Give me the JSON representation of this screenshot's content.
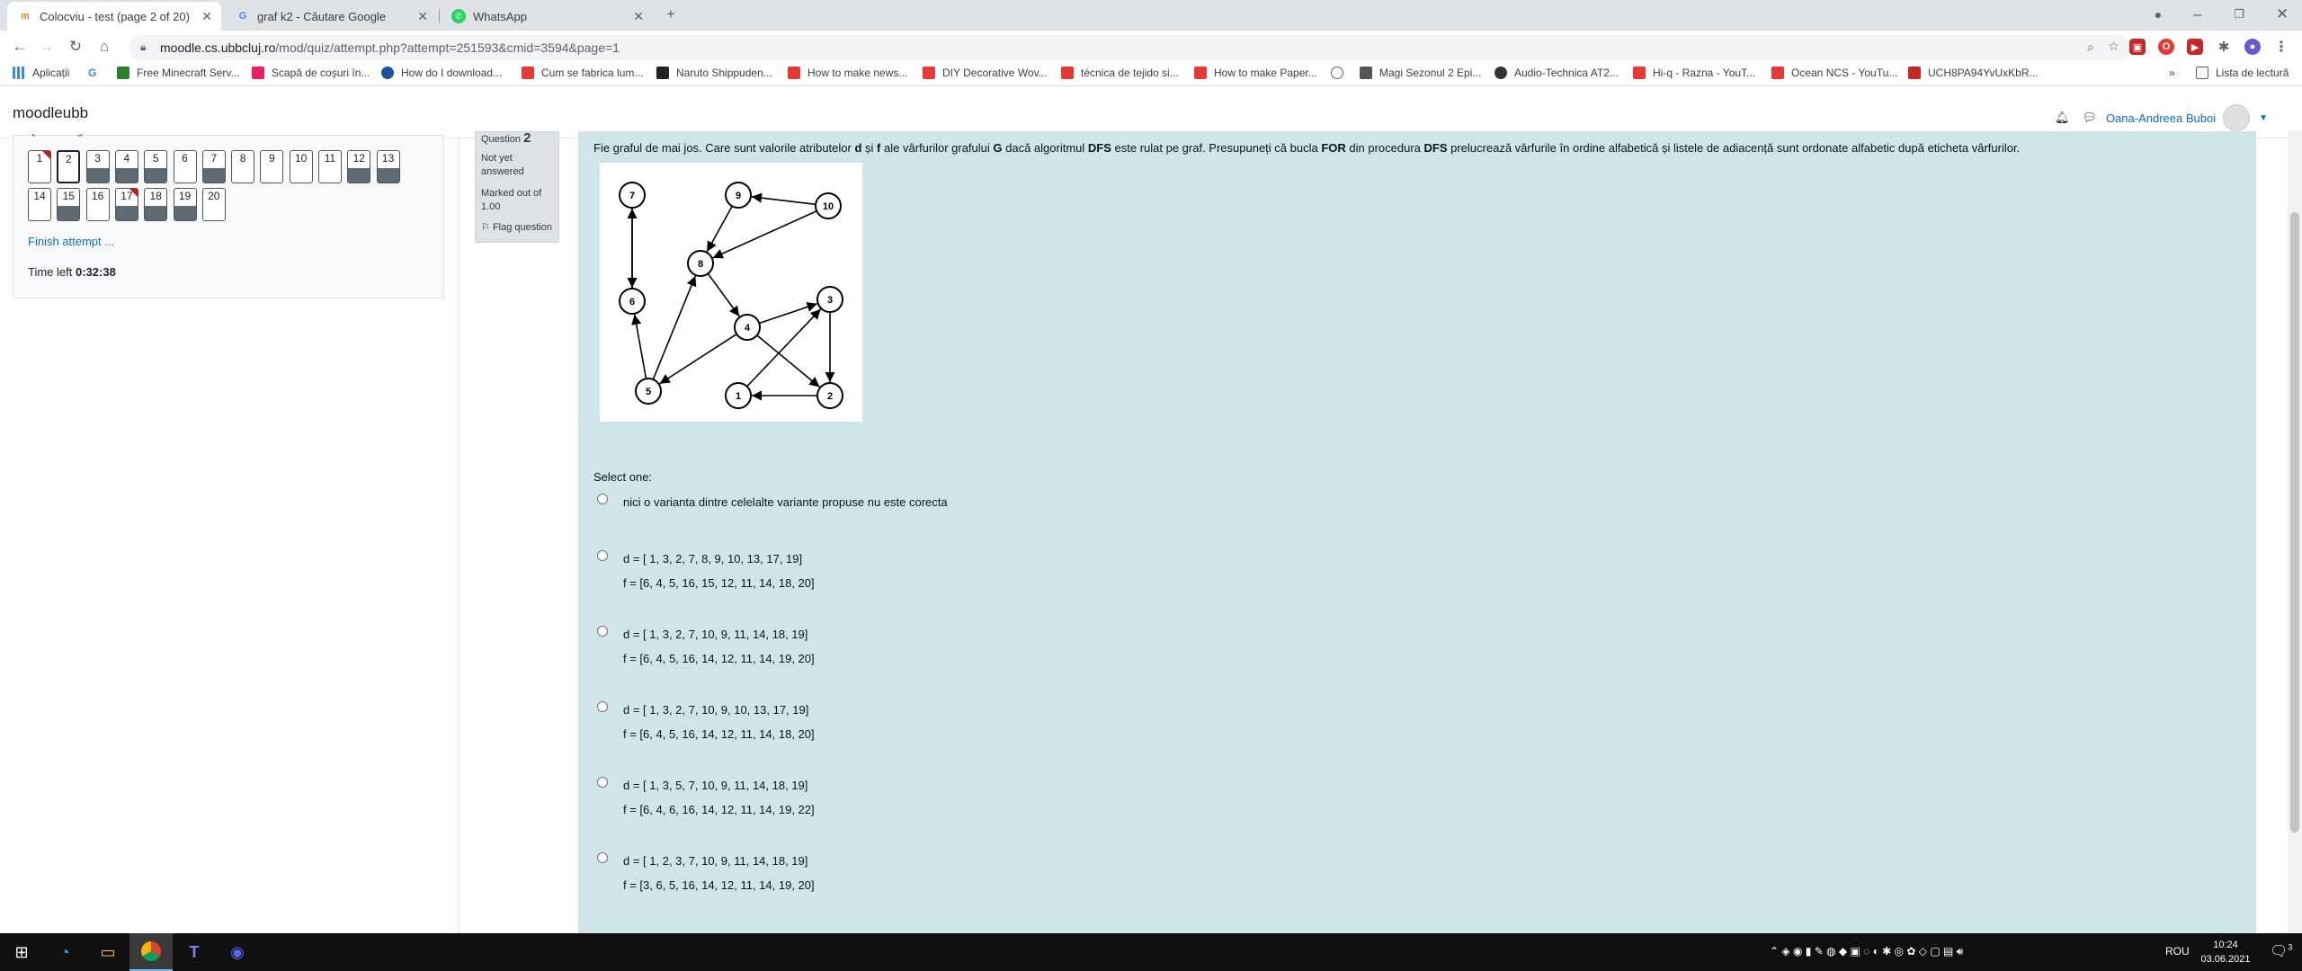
{
  "browser": {
    "tabs": [
      {
        "title": "Colocviu - test (page 2 of 20)",
        "icon": "moodle-icon"
      },
      {
        "title": "graf k2 - Căutare Google",
        "icon": "google-icon"
      },
      {
        "title": "WhatsApp",
        "icon": "whatsapp-icon"
      }
    ],
    "url_host": "moodle.cs.ubbcluj.ro",
    "url_path": "/mod/quiz/attempt.php?attempt=251593&cmid=3594&page=1",
    "bookmarks": [
      "Aplicații",
      "Free Minecraft Serv...",
      "Scapă de coșuri în...",
      "How do I download...",
      "Cum se fabrica lum...",
      "Naruto Shippuden...",
      "How to make news...",
      "DIY Decorative Wov...",
      "técnica de tejido si...",
      "How to make Paper...",
      "Magi Sezonul 2 Epi...",
      "Audio-Technica AT2...",
      "Hi-q - Razna - YouT...",
      "Ocean NCS - YouTu...",
      "UCH8PA94YvUxKbR..."
    ],
    "reading_list": "Lista de lectură"
  },
  "moodle": {
    "brand": "moodleubb",
    "user_name": "Oana-Andreea Buboi",
    "nav": {
      "header": "Quiz navigation",
      "finish": "Finish attempt ...",
      "time_label": "Time left",
      "time_value": "0:32:38",
      "questions": [
        {
          "n": "1",
          "answered": false,
          "flagged": true,
          "current": false
        },
        {
          "n": "2",
          "answered": false,
          "flagged": false,
          "current": true
        },
        {
          "n": "3",
          "answered": true,
          "flagged": false,
          "current": false
        },
        {
          "n": "4",
          "answered": true,
          "flagged": false,
          "current": false
        },
        {
          "n": "5",
          "answered": true,
          "flagged": false,
          "current": false
        },
        {
          "n": "6",
          "answered": false,
          "flagged": false,
          "current": false
        },
        {
          "n": "7",
          "answered": true,
          "flagged": false,
          "current": false
        },
        {
          "n": "8",
          "answered": false,
          "flagged": false,
          "current": false
        },
        {
          "n": "9",
          "answered": false,
          "flagged": false,
          "current": false
        },
        {
          "n": "10",
          "answered": false,
          "flagged": false,
          "current": false
        },
        {
          "n": "11",
          "answered": false,
          "flagged": false,
          "current": false
        },
        {
          "n": "12",
          "answered": true,
          "flagged": false,
          "current": false
        },
        {
          "n": "13",
          "answered": true,
          "flagged": false,
          "current": false
        },
        {
          "n": "14",
          "answered": false,
          "flagged": false,
          "current": false
        },
        {
          "n": "15",
          "answered": true,
          "flagged": false,
          "current": false
        },
        {
          "n": "16",
          "answered": false,
          "flagged": false,
          "current": false
        },
        {
          "n": "17",
          "answered": true,
          "flagged": true,
          "current": false
        },
        {
          "n": "18",
          "answered": true,
          "flagged": false,
          "current": false
        },
        {
          "n": "19",
          "answered": true,
          "flagged": false,
          "current": false
        },
        {
          "n": "20",
          "answered": false,
          "flagged": false,
          "current": false
        }
      ]
    },
    "question": {
      "label": "Question",
      "number": "2",
      "status": "Not yet answered",
      "marked": "Marked out of 1.00",
      "flag": "Flag question",
      "text_parts": [
        {
          "t": "Fie graful de mai jos. Care sunt valorile atributelor ",
          "b": false
        },
        {
          "t": "d",
          "b": true
        },
        {
          "t": " și ",
          "b": false
        },
        {
          "t": "f",
          "b": true
        },
        {
          "t": " ale vârfurilor grafului ",
          "b": false
        },
        {
          "t": "G",
          "b": true
        },
        {
          "t": " dacă algoritmul ",
          "b": false
        },
        {
          "t": "DFS",
          "b": true
        },
        {
          "t": " este rulat pe graf. Presupuneți că bucla ",
          "b": false
        },
        {
          "t": "FOR",
          "b": true
        },
        {
          "t": " din procedura ",
          "b": false
        },
        {
          "t": "DFS",
          "b": true
        },
        {
          "t": " prelucrează vârfurile în ordine alfabetică și listele de adiacență sunt ordonate alfabetic după eticheta vârfurilor.",
          "b": false
        }
      ],
      "select_one": "Select one:",
      "options": [
        {
          "l1": "nici o varianta dintre celelalte variante propuse nu este corecta",
          "l2": ""
        },
        {
          "l1": "d = [ 1, 3, 2, 7, 8, 9, 10, 13, 17, 19]",
          "l2": "f = [6, 4, 5, 16, 15, 12, 11, 14, 18, 20]"
        },
        {
          "l1": "d = [ 1, 3, 2, 7, 10, 9, 11, 14, 18, 19]",
          "l2": "f = [6, 4, 5, 16, 14, 12, 11, 14, 19, 20]"
        },
        {
          "l1": "d = [ 1, 3, 2, 7, 10, 9, 10, 13, 17, 19]",
          "l2": "f = [6, 4, 5, 16, 14, 12, 11, 14, 18, 20]"
        },
        {
          "l1": "d = [ 1, 3, 5, 7, 10, 9, 11, 14, 18, 19]",
          "l2": "f = [6, 4, 6, 16, 14, 12, 11, 14, 19, 22]"
        },
        {
          "l1": "d = [ 1, 2, 3, 7, 10, 9, 11, 14, 18, 19]",
          "l2": "f = [3, 6, 5, 16, 14, 12, 11, 14, 19, 20]"
        }
      ]
    },
    "graph": {
      "nodes": [
        "7",
        "9",
        "10",
        "8",
        "6",
        "4",
        "3",
        "5",
        "1",
        "2"
      ],
      "edges": [
        [
          "10",
          "9"
        ],
        [
          "10",
          "8"
        ],
        [
          "9",
          "8"
        ],
        [
          "7",
          "6"
        ],
        [
          "6",
          "7"
        ],
        [
          "8",
          "4"
        ],
        [
          "5",
          "6"
        ],
        [
          "5",
          "8"
        ],
        [
          "4",
          "5"
        ],
        [
          "4",
          "3"
        ],
        [
          "4",
          "2"
        ],
        [
          "1",
          "3"
        ],
        [
          "3",
          "2"
        ],
        [
          "2",
          "1"
        ]
      ]
    }
  },
  "taskbar": {
    "language": "ROU",
    "time": "10:24",
    "date": "03.06.2021",
    "notifications": "3"
  }
}
